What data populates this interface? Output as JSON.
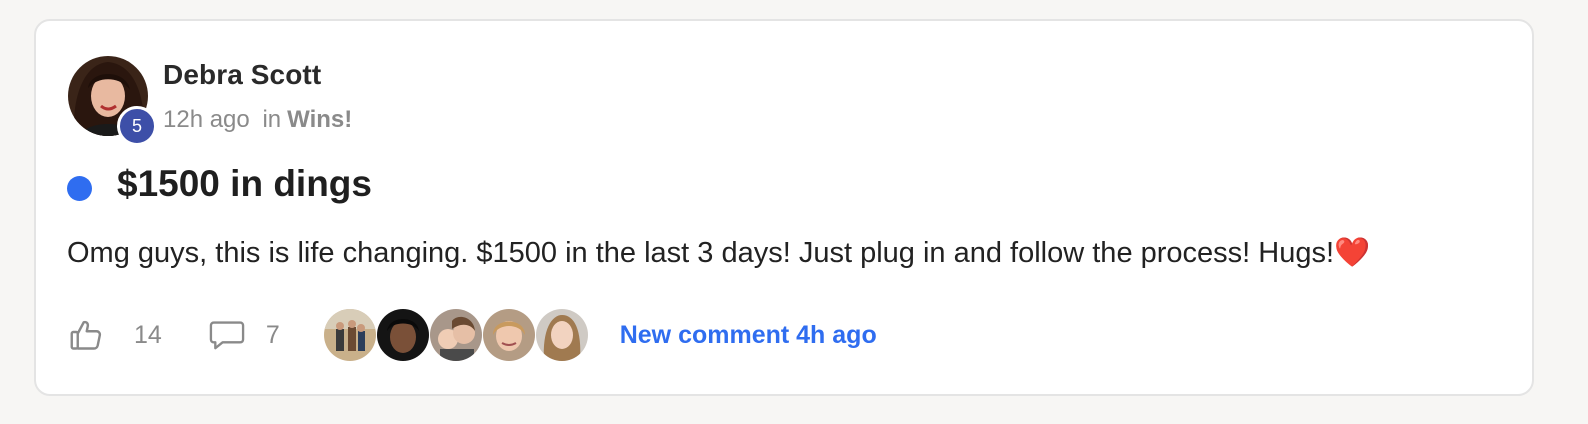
{
  "post": {
    "author": "Debra Scott",
    "level": "5",
    "time_ago": "12h ago",
    "in_word": "in",
    "category": "Wins!",
    "title": "$1500 in dings",
    "body": "Omg guys, this is life changing. $1500 in the last 3 days! Just plug in and follow the process! Hugs!❤️"
  },
  "actions": {
    "like_icon": "thumbs-up-icon",
    "likes": "14",
    "comment_icon": "comment-bubble-icon",
    "comments": "7",
    "new_comment": "New comment 4h ago"
  },
  "colors": {
    "accent": "#2f6df0",
    "level_badge": "#3d4fa8",
    "muted_text": "#8a8a8a"
  }
}
